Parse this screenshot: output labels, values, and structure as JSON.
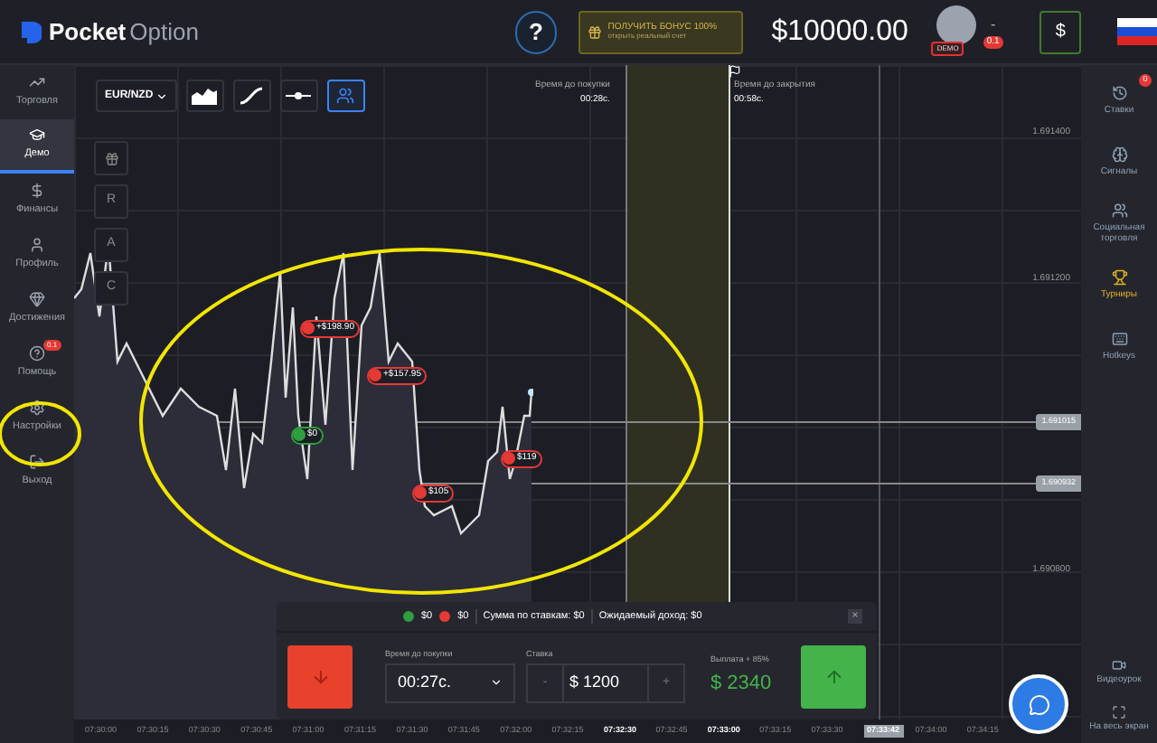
{
  "header": {
    "logo_bold": "Pocket",
    "logo_light": "Option",
    "help": "?",
    "bonus": {
      "title": "ПОЛУЧИТЬ БОНУС 100%",
      "subtitle": "открыть реальный счет"
    },
    "balance": "$10000.00",
    "account_badge": "DEMO",
    "account_dash": "-",
    "level_badge": "0.1",
    "deposit": "$"
  },
  "left_nav": [
    {
      "label": "Торговля",
      "selected": false
    },
    {
      "label": "Демо",
      "selected": true
    },
    {
      "label": "Финансы",
      "selected": false
    },
    {
      "label": "Профиль",
      "selected": false
    },
    {
      "label": "Достижения",
      "selected": false
    },
    {
      "label": "Помощь",
      "selected": false,
      "badge": "0.1"
    },
    {
      "label": "Настройки",
      "selected": false
    },
    {
      "label": "Выход",
      "selected": false
    }
  ],
  "toolbar": {
    "pair": "EUR/NZD",
    "tools": [
      {
        "kind": "area",
        "selected": false
      },
      {
        "kind": "line",
        "selected": false
      },
      {
        "kind": "slider",
        "selected": false
      },
      {
        "kind": "people",
        "selected": true
      }
    ],
    "side_tools": [
      "R",
      "A",
      "C"
    ]
  },
  "timers": {
    "buy_label": "Время до покупки",
    "buy_value": "00:28с.",
    "close_label": "Время до закрытия",
    "close_value": "00:58с."
  },
  "y_ticks": [
    "1.691400",
    "1.691200",
    "1.690800"
  ],
  "price_labels": [
    "1.691015",
    "1.690932"
  ],
  "trades": [
    {
      "label": "+$198.90",
      "color": "#e53935"
    },
    {
      "label": "+$157.95",
      "color": "#e53935"
    },
    {
      "label": "$0",
      "color": "#2e9e3e"
    },
    {
      "label": "$105",
      "color": "#e53935"
    },
    {
      "label": "$119",
      "color": "#e53935"
    }
  ],
  "trade_panel": {
    "up_total": "$0",
    "down_total": "$0",
    "stakes_sum": "Сумма по ставкам: $0",
    "expected": "Ожидаемый доход: $0",
    "close": "×",
    "time_label": "Время до покупки",
    "time_value": "00:27с.",
    "stake_label": "Ставка",
    "minus": "-",
    "stake_value": "$ 1200",
    "plus": "+",
    "payout_label": "Выплата + 85%",
    "payout_value": "$ 2340"
  },
  "x_ticks": [
    {
      "label": "07:30:00",
      "bold": false
    },
    {
      "label": "07:30:15",
      "bold": false
    },
    {
      "label": "07:30:30",
      "bold": false
    },
    {
      "label": "07:30:45",
      "bold": false
    },
    {
      "label": "07:31:00",
      "bold": false
    },
    {
      "label": "07:31:15",
      "bold": false
    },
    {
      "label": "07:31:30",
      "bold": false
    },
    {
      "label": "07:31:45",
      "bold": false
    },
    {
      "label": "07:32:00",
      "bold": false
    },
    {
      "label": "07:32:15",
      "bold": false
    },
    {
      "label": "07:32:30",
      "bold": true
    },
    {
      "label": "07:32:45",
      "bold": false
    },
    {
      "label": "07:33:00",
      "bold": true
    },
    {
      "label": "07:33:15",
      "bold": false
    },
    {
      "label": "07:33:30",
      "bold": false
    },
    {
      "label": "07:33:42",
      "bold": true,
      "current": true
    },
    {
      "label": "07:34:00",
      "bold": false
    },
    {
      "label": "07:34:15",
      "bold": false
    }
  ],
  "right_nav": [
    {
      "label": "Ставки",
      "badge": "0",
      "highlight": false
    },
    {
      "label": "Сигналы",
      "highlight": false
    },
    {
      "label": "Социальная торговля",
      "highlight": false
    },
    {
      "label": "Турниры",
      "highlight": true
    },
    {
      "label": "Hotkeys",
      "highlight": false
    }
  ],
  "right_bottom": [
    {
      "label": "Видеоурок"
    },
    {
      "label": "На весь экран"
    }
  ]
}
